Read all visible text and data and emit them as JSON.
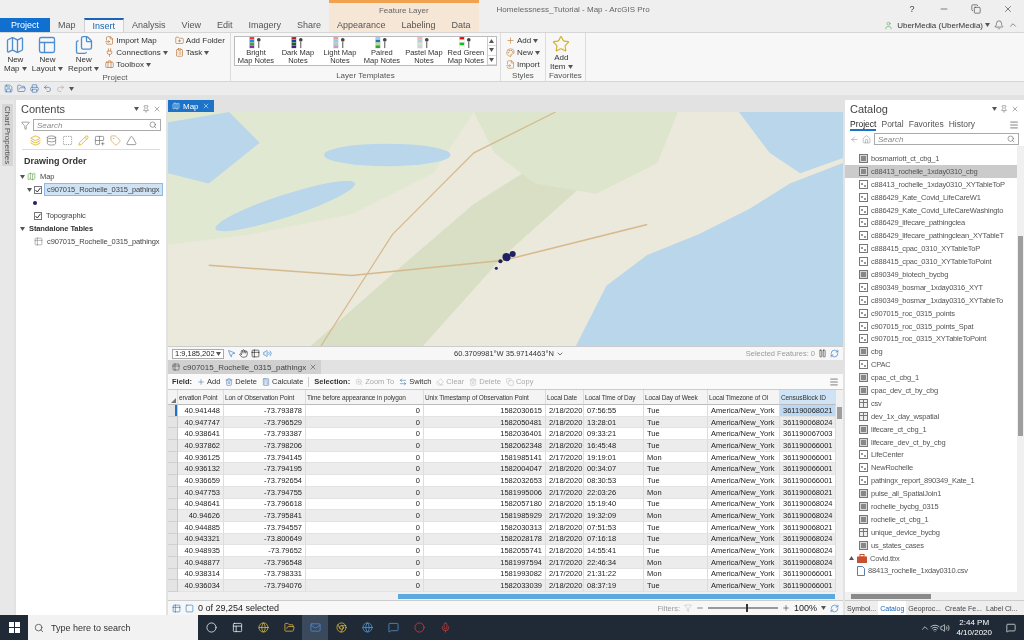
{
  "window": {
    "title": "Homelessness_Tutorial - Map - ArcGIS Pro",
    "help": "?",
    "user": "UberMedia (UberMedia)"
  },
  "contextual_group": {
    "label": "Feature Layer"
  },
  "ribbon_tabs": [
    {
      "label": "Project",
      "kind": "backstage",
      "selected": false
    },
    {
      "label": "Map",
      "kind": "core",
      "selected": false
    },
    {
      "label": "Insert",
      "kind": "core",
      "selected": true
    },
    {
      "label": "Analysis",
      "kind": "core",
      "selected": false
    },
    {
      "label": "View",
      "kind": "core",
      "selected": false
    },
    {
      "label": "Edit",
      "kind": "core",
      "selected": false
    },
    {
      "label": "Imagery",
      "kind": "core",
      "selected": false
    },
    {
      "label": "Share",
      "kind": "core",
      "selected": false
    },
    {
      "label": "Appearance",
      "kind": "contextual",
      "selected": false
    },
    {
      "label": "Labeling",
      "kind": "contextual",
      "selected": false
    },
    {
      "label": "Data",
      "kind": "contextual",
      "selected": false
    }
  ],
  "ribbon": {
    "project_group": {
      "label": "Project",
      "large_buttons": [
        {
          "lines": [
            "New",
            "Map"
          ],
          "dropdown": true
        },
        {
          "lines": [
            "New",
            "Layout"
          ],
          "dropdown": true
        },
        {
          "lines": [
            "New",
            "Report"
          ],
          "dropdown": true
        }
      ],
      "small_buttons": [
        {
          "label": "Import Map",
          "dropdown": false
        },
        {
          "label": "Connections",
          "dropdown": true
        },
        {
          "label": "Toolbox",
          "dropdown": true
        },
        {
          "label": "Add Folder",
          "dropdown": false
        },
        {
          "label": "Task",
          "dropdown": true
        }
      ]
    },
    "templates_group": {
      "label": "Layer Templates",
      "items": [
        {
          "lines": [
            "Bright",
            "Map Notes"
          ]
        },
        {
          "lines": [
            "Dark Map",
            "Notes"
          ]
        },
        {
          "lines": [
            "Light Map",
            "Notes"
          ]
        },
        {
          "lines": [
            "Paired",
            "Map Notes"
          ]
        },
        {
          "lines": [
            "Pastel Map",
            "Notes"
          ]
        },
        {
          "lines": [
            "Red Green",
            "Map Notes"
          ]
        }
      ]
    },
    "styles_group": {
      "label": "Styles",
      "buttons": [
        {
          "label": "Add",
          "dropdown": true
        },
        {
          "label": "New",
          "dropdown": true
        },
        {
          "label": "Import",
          "dropdown": false
        }
      ]
    },
    "favorites_group": {
      "label": "Favorites",
      "button": {
        "lines": [
          "Add",
          "Item"
        ],
        "dropdown": true
      }
    }
  },
  "side_strip": {
    "label": "Chart Properties"
  },
  "contents": {
    "title": "Contents",
    "search_placeholder": "Search",
    "heading": "Drawing Order",
    "tree": [
      {
        "label": "Map",
        "kind": "map",
        "selected": false,
        "expanded": true,
        "children": [
          {
            "label": "c907015_Rochelle_0315_pathingx",
            "kind": "layer",
            "checked": true,
            "selected": true,
            "expanded": true,
            "children": [
              {
                "kind": "symbol"
              }
            ]
          },
          {
            "label": "Topographic",
            "kind": "layer",
            "checked": true,
            "selected": false
          }
        ]
      },
      {
        "label": "Standalone Tables",
        "kind": "group",
        "selected": false,
        "expanded": true,
        "children": [
          {
            "label": "c907015_Rochelle_0315_pathingx",
            "kind": "table",
            "selected": false
          }
        ]
      }
    ]
  },
  "map_view": {
    "tab": "Map",
    "scale": "1:9,185,202",
    "coordinates": "60.3709981°W 35.9714463°N",
    "selected_features": "Selected Features: 0"
  },
  "attribute_table": {
    "tab": "c907015_Rochelle_0315_pathingx",
    "field_label": "Field:",
    "field_tools": [
      {
        "label": "Add",
        "disabled": false
      },
      {
        "label": "Delete",
        "disabled": false
      },
      {
        "label": "Calculate",
        "disabled": false
      }
    ],
    "selection_label": "Selection:",
    "selection_tools": [
      {
        "label": "Zoom To",
        "disabled": true
      },
      {
        "label": "Switch",
        "disabled": false
      },
      {
        "label": "Clear",
        "disabled": true
      },
      {
        "label": "Delete",
        "disabled": true
      },
      {
        "label": "Copy",
        "disabled": true
      }
    ],
    "columns": [
      {
        "label": "ervation Point",
        "selected": false
      },
      {
        "label": "Lon of Observation Point",
        "selected": false
      },
      {
        "label": "Time before appearance in polygon",
        "selected": false
      },
      {
        "label": "Unix Timestamp of Observation Point",
        "selected": false
      },
      {
        "label": "Local Date",
        "selected": false
      },
      {
        "label": "Local Time of Day",
        "selected": false
      },
      {
        "label": "Local Day of Week",
        "selected": false
      },
      {
        "label": "Local Timezone of Ol",
        "selected": false
      },
      {
        "label": "CensusBlock ID",
        "selected": true
      }
    ],
    "rows": [
      {
        "selected": true,
        "cells": [
          "40.941448",
          "-73.793878",
          "0",
          "1582030615",
          "2/18/2020",
          "07:56:55",
          "Tue",
          "America/New_York",
          "361190068021"
        ]
      },
      {
        "selected": false,
        "cells": [
          "40.947747",
          "-73.796529",
          "0",
          "1582050481",
          "2/18/2020",
          "13:28:01",
          "Tue",
          "America/New_York",
          "361190068024"
        ]
      },
      {
        "selected": false,
        "cells": [
          "40.938641",
          "-73.793387",
          "0",
          "1582036401",
          "2/18/2020",
          "09:33:21",
          "Tue",
          "America/New_York",
          "361190067003"
        ]
      },
      {
        "selected": false,
        "cells": [
          "40.937862",
          "-73.798206",
          "0",
          "1582062348",
          "2/18/2020",
          "16:45:48",
          "Tue",
          "America/New_York",
          "361190066001"
        ]
      },
      {
        "selected": false,
        "cells": [
          "40.936125",
          "-73.794145",
          "0",
          "1581985141",
          "2/17/2020",
          "19:19:01",
          "Mon",
          "America/New_York",
          "361190066001"
        ]
      },
      {
        "selected": false,
        "cells": [
          "40.936132",
          "-73.794195",
          "0",
          "1582004047",
          "2/18/2020",
          "00:34:07",
          "Tue",
          "America/New_York",
          "361190066001"
        ]
      },
      {
        "selected": false,
        "cells": [
          "40.936659",
          "-73.792654",
          "0",
          "1582032653",
          "2/18/2020",
          "08:30:53",
          "Tue",
          "America/New_York",
          "361190066001"
        ]
      },
      {
        "selected": false,
        "cells": [
          "40.947753",
          "-73.794755",
          "0",
          "1581995006",
          "2/17/2020",
          "22:03:26",
          "Mon",
          "America/New_York",
          "361190068021"
        ]
      },
      {
        "selected": false,
        "cells": [
          "40.948641",
          "-73.796618",
          "0",
          "1582057180",
          "2/18/2020",
          "15:19:40",
          "Tue",
          "America/New_York",
          "361190068024"
        ]
      },
      {
        "selected": false,
        "cells": [
          "40.94626",
          "-73.795841",
          "0",
          "1581985929",
          "2/17/2020",
          "19:32:09",
          "Mon",
          "America/New_York",
          "361190068024"
        ]
      },
      {
        "selected": false,
        "cells": [
          "40.944885",
          "-73.794557",
          "0",
          "1582030313",
          "2/18/2020",
          "07:51:53",
          "Tue",
          "America/New_York",
          "361190068021"
        ]
      },
      {
        "selected": false,
        "cells": [
          "40.943321",
          "-73.800649",
          "0",
          "1582028178",
          "2/18/2020",
          "07:16:18",
          "Tue",
          "America/New_York",
          "361190068024"
        ]
      },
      {
        "selected": false,
        "cells": [
          "40.948935",
          "-73.79652",
          "0",
          "1582055741",
          "2/18/2020",
          "14:55:41",
          "Tue",
          "America/New_York",
          "361190068024"
        ]
      },
      {
        "selected": false,
        "cells": [
          "40.948877",
          "-73.796548",
          "0",
          "1581997594",
          "2/17/2020",
          "22:46:34",
          "Mon",
          "America/New_York",
          "361190068024"
        ]
      },
      {
        "selected": false,
        "cells": [
          "40.938314",
          "-73.798331",
          "0",
          "1581993082",
          "2/17/2020",
          "21:31:22",
          "Mon",
          "America/New_York",
          "361190066001"
        ]
      },
      {
        "selected": false,
        "cells": [
          "40.936034",
          "-73.794076",
          "0",
          "1582033039",
          "2/18/2020",
          "08:37:19",
          "Tue",
          "America/New_York",
          "361190066001"
        ]
      }
    ],
    "selection_count": "0 of 29,254 selected",
    "filters_label": "Filters:",
    "zoom": {
      "level": 0.55,
      "reading": "100%"
    }
  },
  "catalog": {
    "title": "Catalog",
    "tabs": [
      {
        "label": "Project",
        "selected": true
      },
      {
        "label": "Portal",
        "selected": false
      },
      {
        "label": "Favorites",
        "selected": false
      },
      {
        "label": "History",
        "selected": false
      }
    ],
    "search_placeholder": "Search",
    "gdb_items": [
      {
        "label": "bosmarriott_ct_cbg_1",
        "kind": "polygon",
        "selected": false
      },
      {
        "label": "c88413_rochelle_1xday0310_cbg",
        "kind": "polygon",
        "selected": true
      },
      {
        "label": "c88413_rochelle_1xday0310_XYTableToP",
        "kind": "point",
        "selected": false
      },
      {
        "label": "c886429_Kate_Covid_LifeCareW1",
        "kind": "point",
        "selected": false
      },
      {
        "label": "c886429_Kate_Covid_LifeCareWashingto",
        "kind": "point",
        "selected": false
      },
      {
        "label": "c886429_lifecare_pathingclea",
        "kind": "point",
        "selected": false
      },
      {
        "label": "c886429_lifecare_pathingclean_XYTableT",
        "kind": "point",
        "selected": false
      },
      {
        "label": "c888415_cpac_0310_XYTableToP",
        "kind": "point",
        "selected": false
      },
      {
        "label": "c888415_cpac_0310_XYTableToPoint",
        "kind": "point",
        "selected": false
      },
      {
        "label": "c890349_biotech_bycbg",
        "kind": "polygon",
        "selected": false
      },
      {
        "label": "c890349_bosmar_1xday0316_XYT",
        "kind": "point",
        "selected": false
      },
      {
        "label": "c890349_bosmar_1xday0316_XYTableTo",
        "kind": "point",
        "selected": false
      },
      {
        "label": "c907015_roc_0315_points",
        "kind": "point",
        "selected": false
      },
      {
        "label": "c907015_roc_0315_points_Spat",
        "kind": "point",
        "selected": false
      },
      {
        "label": "c907015_roc_0315_XYTableToPoint",
        "kind": "point",
        "selected": false
      },
      {
        "label": "cbg",
        "kind": "polygon",
        "selected": false
      },
      {
        "label": "CPAC",
        "kind": "point",
        "selected": false
      },
      {
        "label": "cpac_ct_cbg_1",
        "kind": "polygon",
        "selected": false
      },
      {
        "label": "cpac_dev_ct_by_cbg",
        "kind": "polygon",
        "selected": false
      },
      {
        "label": "csv",
        "kind": "table",
        "selected": false
      },
      {
        "label": "dev_1x_day_wspatial",
        "kind": "table",
        "selected": false
      },
      {
        "label": "lifecare_ct_cbg_1",
        "kind": "polygon",
        "selected": false
      },
      {
        "label": "lifecare_dev_ct_by_cbg",
        "kind": "polygon",
        "selected": false
      },
      {
        "label": "LifeCenter",
        "kind": "point",
        "selected": false
      },
      {
        "label": "NewRochelle",
        "kind": "point",
        "selected": false
      },
      {
        "label": "pathingx_report_890349_Kate_1",
        "kind": "point",
        "selected": false
      },
      {
        "label": "pulse_all_SpatialJoin1",
        "kind": "polygon",
        "selected": false
      },
      {
        "label": "rochelle_bycbg_0315",
        "kind": "polygon",
        "selected": false
      },
      {
        "label": "rochelle_ct_cbg_1",
        "kind": "polygon",
        "selected": false
      },
      {
        "label": "unique_device_bycbg",
        "kind": "table",
        "selected": false
      },
      {
        "label": "us_states_cases",
        "kind": "polygon",
        "selected": false
      }
    ],
    "folder_items": [
      {
        "label": "Covid.tbx",
        "kind": "toolbox",
        "selected": false,
        "expanded": false
      },
      {
        "label": "88413_rochelle_1xday0310.csv",
        "kind": "file",
        "selected": false
      }
    ],
    "bottom_tabs": [
      {
        "label": "Symbol...",
        "selected": false
      },
      {
        "label": "Catalog",
        "selected": true
      },
      {
        "label": "Geoproc...",
        "selected": false
      },
      {
        "label": "Create Fe...",
        "selected": false
      },
      {
        "label": "Label Cl...",
        "selected": false
      }
    ]
  },
  "taskbar": {
    "search_placeholder": "Type here to search",
    "time": "2:44 PM",
    "date": "4/10/2020"
  }
}
